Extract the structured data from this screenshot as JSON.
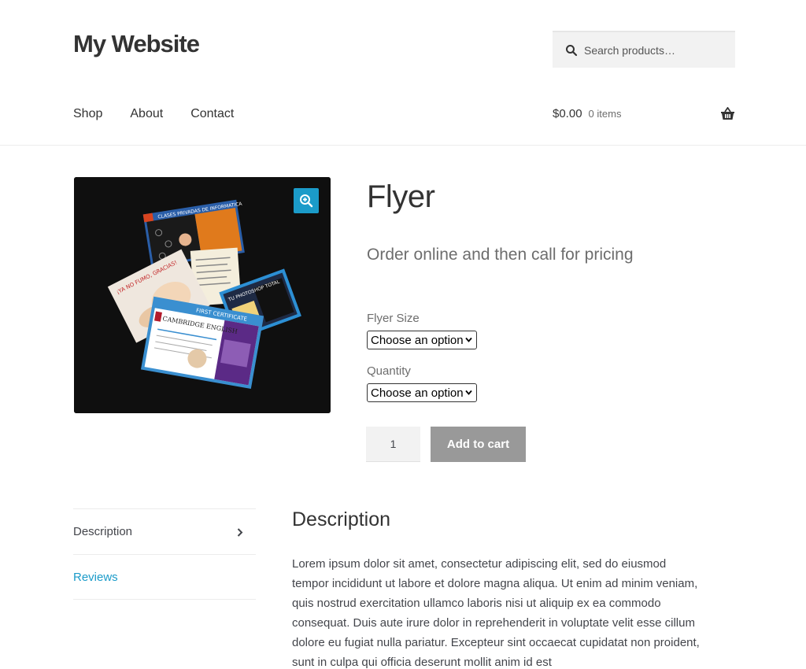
{
  "site": {
    "title": "My Website"
  },
  "search": {
    "placeholder": "Search products…"
  },
  "nav": {
    "items": [
      "Shop",
      "About",
      "Contact"
    ]
  },
  "cart": {
    "amount": "$0.00",
    "count": "0 items"
  },
  "product": {
    "title": "Flyer",
    "price_note": "Order online and then call for pricing",
    "variations": [
      {
        "label": "Flyer Size",
        "selected": "Choose an option"
      },
      {
        "label": "Quantity",
        "selected": "Choose an option"
      }
    ],
    "quantity": "1",
    "add_to_cart_label": "Add to cart"
  },
  "tabs": {
    "items": [
      "Description",
      "Reviews"
    ]
  },
  "description": {
    "heading": "Description",
    "body": "Lorem ipsum dolor sit amet, consectetur adipiscing elit, sed do eiusmod tempor incididunt ut labore et dolore magna aliqua. Ut enim ad minim veniam, quis nostrud exercitation ullamco laboris nisi ut aliquip ex ea commodo consequat. Duis aute irure dolor in reprehenderit in voluptate velit esse cillum dolore eu fugiat nulla pariatur. Excepteur sint occaecat cupidatat non proident, sunt in culpa qui officia deserunt mollit anim id est"
  },
  "image_text": {
    "flyer_1": "CLASES PRIVADAS DE INFORMATICA",
    "flyer_2": "¡YA NO FUMO, GRACIAS!",
    "flyer_3": "TU PHOTOSHOP TOTAL",
    "flyer_4_title": "FIRST CERTIFICATE",
    "flyer_4_sub": "CAMBRIDGE ENGLISH"
  },
  "colors": {
    "accent": "#1b9bc9",
    "button_disabled": "#999999",
    "text": "#43454b"
  },
  "icons": {
    "search": "search-icon",
    "basket": "basket-icon",
    "zoom": "zoom-icon",
    "chevron_down": "chevron-down-icon",
    "chevron_right": "chevron-right-icon"
  }
}
